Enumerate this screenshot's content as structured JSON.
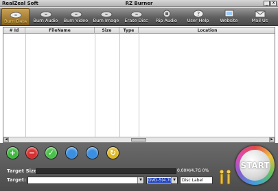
{
  "window": {
    "app_name": "RealZeal Soft",
    "title": "RZ Burner",
    "min": "_",
    "close": "X"
  },
  "toolbar": [
    {
      "label": "Burn Data",
      "icon": "disc-data-icon",
      "active": true
    },
    {
      "label": "Burn Audio",
      "icon": "disc-audio-icon"
    },
    {
      "label": "Burn Video",
      "icon": "disc-video-icon"
    },
    {
      "label": "Burn Image",
      "icon": "disc-image-icon"
    },
    {
      "label": "Erase Disc",
      "icon": "disc-erase-icon"
    },
    {
      "label": "Rip Audio",
      "icon": "rip-audio-icon"
    },
    {
      "label": "User Help",
      "icon": "help-icon"
    },
    {
      "label": "Website",
      "icon": "website-icon"
    },
    {
      "label": "Mail Us",
      "icon": "mail-icon"
    }
  ],
  "table": {
    "columns": [
      "# Id",
      "FileName",
      "Size",
      "Type",
      "Location"
    ],
    "rows": []
  },
  "actions": [
    {
      "name": "add",
      "symbol": "+",
      "color": "#3db93d"
    },
    {
      "name": "remove",
      "symbol": "−",
      "color": "#d83030"
    },
    {
      "name": "check",
      "symbol": "✓",
      "color": "#4cbf4c"
    },
    {
      "name": "blue-a",
      "symbol": "",
      "color": "#3b8fe0"
    },
    {
      "name": "blue-b",
      "symbol": "",
      "color": "#3b8fe0"
    },
    {
      "name": "refresh",
      "symbol": "↻",
      "color": "#e0b820"
    }
  ],
  "target_size": {
    "label": "Target Size:",
    "value": "0.00M/4.7G",
    "percent": "0%"
  },
  "target": {
    "label": "Target:",
    "value": ""
  },
  "disc_type": "DVD-5(4.7G)",
  "disc_label": "Disc Label",
  "start_label": "START"
}
